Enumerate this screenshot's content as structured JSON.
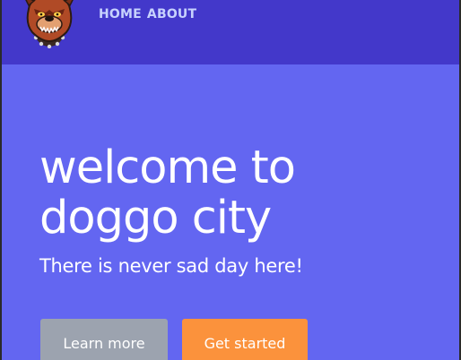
{
  "nav": {
    "links": [
      {
        "label": "HOME"
      },
      {
        "label": "ABOUT"
      }
    ]
  },
  "logo": {
    "icon": "bulldog-mascot-icon"
  },
  "hero": {
    "title_line1": "welcome to",
    "title_line2": "doggo city",
    "subtitle": "There is never sad day here!"
  },
  "actions": {
    "learn_more_label": "Learn more",
    "get_started_label": "Get started"
  },
  "colors": {
    "navbar": "#4338ca",
    "hero_background": "#6366f1",
    "nav_link": "#c7d2fe",
    "secondary_button": "#9ca3af",
    "primary_button": "#fb923c"
  }
}
